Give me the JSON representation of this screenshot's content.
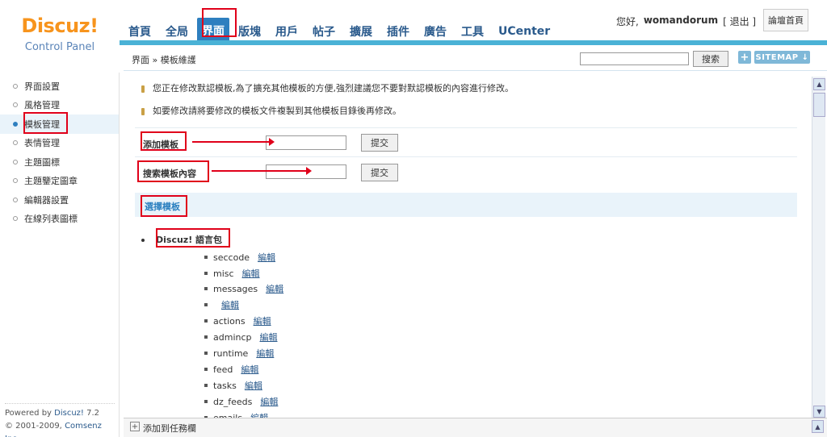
{
  "logo": {
    "main": "Discuz!",
    "sub": "Control Panel"
  },
  "nav": [
    "首頁",
    "全局",
    "界面",
    "版塊",
    "用戶",
    "帖子",
    "擴展",
    "插件",
    "廣告",
    "工具",
    "UCenter"
  ],
  "nav_active": "界面",
  "user": {
    "greeting": "您好,",
    "name": "womandorum",
    "logout": "[ 退出 ]",
    "home": "論壇首頁"
  },
  "breadcrumb": "界面 » 模板維護",
  "search": {
    "button": "搜索",
    "value": ""
  },
  "sitemap": {
    "plus": "+",
    "label": "SITEMAP ↓"
  },
  "sidebar": {
    "items": [
      "界面設置",
      "風格管理",
      "模板管理",
      "表情管理",
      "主題圖標",
      "主題鑒定圖章",
      "編輯器設置",
      "在線列表圖標"
    ],
    "active": "模板管理"
  },
  "footer": {
    "powered": "Powered by",
    "brand": "Discuz!",
    "version": "7.2",
    "copyright": "© 2001-2009,",
    "company": "Comsenz Inc."
  },
  "tips": [
    "您正在修改默認模板,為了擴充其他模板的方便,強烈建議您不要對默認模板的內容進行修改。",
    "如要修改請將要修改的模板文件複製到其他模板目錄後再修改。"
  ],
  "forms": {
    "add_label": "添加模板",
    "search_label": "搜索模板內容",
    "submit": "提交"
  },
  "section": {
    "title": "選擇模板"
  },
  "package": {
    "title": "Discuz! 語言包"
  },
  "templates": [
    {
      "name": "seccode",
      "edit": "編輯"
    },
    {
      "name": "misc",
      "edit": "編輯"
    },
    {
      "name": "messages",
      "edit": "編輯"
    },
    {
      "name": "",
      "edit": "編輯"
    },
    {
      "name": "actions",
      "edit": "編輯"
    },
    {
      "name": "admincp",
      "edit": "編輯"
    },
    {
      "name": "runtime",
      "edit": "編輯"
    },
    {
      "name": "feed",
      "edit": "編輯"
    },
    {
      "name": "tasks",
      "edit": "編輯"
    },
    {
      "name": "dz_feeds",
      "edit": "編輯"
    },
    {
      "name": "emails",
      "edit": "編輯"
    }
  ],
  "bottom": {
    "plus": "+",
    "label": "添加到任務欄"
  },
  "colors": {
    "accent": "#2e7fbf",
    "logo": "#f7941d",
    "annotation": "#e0001a",
    "nav_bar": "#4ab2d6"
  }
}
